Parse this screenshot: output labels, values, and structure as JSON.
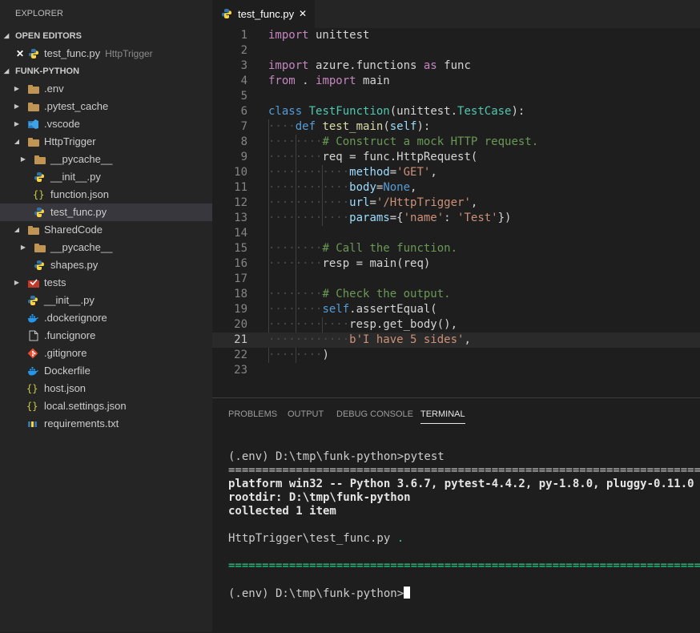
{
  "sidebar": {
    "title": "EXPLORER",
    "open_editors": {
      "header": "OPEN EDITORS",
      "items": [
        {
          "close": "✕",
          "label": "test_func.py",
          "description": "HttpTrigger"
        }
      ]
    },
    "project": {
      "header": "FUNK-PYTHON",
      "items": [
        {
          "label": ".env"
        },
        {
          "label": ".pytest_cache"
        },
        {
          "label": ".vscode"
        },
        {
          "label": "HttpTrigger"
        },
        {
          "label": "__pycache__"
        },
        {
          "label": "__init__.py"
        },
        {
          "label": "function.json"
        },
        {
          "label": "test_func.py"
        },
        {
          "label": "SharedCode"
        },
        {
          "label": "__pycache__"
        },
        {
          "label": "shapes.py"
        },
        {
          "label": "tests"
        },
        {
          "label": "__init__.py"
        },
        {
          "label": ".dockerignore"
        },
        {
          "label": ".funcignore"
        },
        {
          "label": ".gitignore"
        },
        {
          "label": "Dockerfile"
        },
        {
          "label": "host.json"
        },
        {
          "label": "local.settings.json"
        },
        {
          "label": "requirements.txt"
        }
      ]
    }
  },
  "editor": {
    "tab": {
      "label": "test_func.py",
      "close": "✕"
    },
    "current_line": 21,
    "lines": [
      {
        "n": "1",
        "tokens": [
          [
            "kw",
            "import"
          ],
          [
            "txt",
            " unittest"
          ]
        ]
      },
      {
        "n": "2",
        "tokens": []
      },
      {
        "n": "3",
        "tokens": [
          [
            "kw",
            "import"
          ],
          [
            "txt",
            " azure.functions "
          ],
          [
            "kw",
            "as"
          ],
          [
            "txt",
            " func"
          ]
        ]
      },
      {
        "n": "4",
        "tokens": [
          [
            "kw",
            "from"
          ],
          [
            "txt",
            " . "
          ],
          [
            "kw",
            "import"
          ],
          [
            "txt",
            " main"
          ]
        ]
      },
      {
        "n": "5",
        "tokens": []
      },
      {
        "n": "6",
        "tokens": [
          [
            "kwb",
            "class"
          ],
          [
            "txt",
            " "
          ],
          [
            "cls",
            "TestFunction"
          ],
          [
            "txt",
            "(unittest."
          ],
          [
            "cls",
            "TestCase"
          ],
          [
            "txt",
            "):"
          ]
        ]
      },
      {
        "n": "7",
        "tokens": [
          [
            "ws",
            "····"
          ],
          [
            "kwb",
            "def"
          ],
          [
            "txt",
            " "
          ],
          [
            "fn",
            "test_main"
          ],
          [
            "txt",
            "("
          ],
          [
            "prm",
            "self"
          ],
          [
            "txt",
            "):"
          ]
        ]
      },
      {
        "n": "8",
        "tokens": [
          [
            "ws",
            "········"
          ],
          [
            "cmt",
            "# Construct a mock HTTP request."
          ]
        ]
      },
      {
        "n": "9",
        "tokens": [
          [
            "ws",
            "········"
          ],
          [
            "txt",
            "req = func.HttpRequest("
          ]
        ]
      },
      {
        "n": "10",
        "tokens": [
          [
            "ws",
            "············"
          ],
          [
            "prm",
            "method"
          ],
          [
            "txt",
            "="
          ],
          [
            "str",
            "'GET'"
          ],
          [
            "txt",
            ","
          ]
        ]
      },
      {
        "n": "11",
        "tokens": [
          [
            "ws",
            "············"
          ],
          [
            "prm",
            "body"
          ],
          [
            "txt",
            "="
          ],
          [
            "kwb",
            "None"
          ],
          [
            "txt",
            ","
          ]
        ]
      },
      {
        "n": "12",
        "tokens": [
          [
            "ws",
            "············"
          ],
          [
            "prm",
            "url"
          ],
          [
            "txt",
            "="
          ],
          [
            "str",
            "'/HttpTrigger'"
          ],
          [
            "txt",
            ","
          ]
        ]
      },
      {
        "n": "13",
        "tokens": [
          [
            "ws",
            "············"
          ],
          [
            "prm",
            "params"
          ],
          [
            "txt",
            "={"
          ],
          [
            "str",
            "'name'"
          ],
          [
            "txt",
            ": "
          ],
          [
            "str",
            "'Test'"
          ],
          [
            "txt",
            "})"
          ]
        ]
      },
      {
        "n": "14",
        "tokens": []
      },
      {
        "n": "15",
        "tokens": [
          [
            "ws",
            "········"
          ],
          [
            "cmt",
            "# Call the function."
          ]
        ]
      },
      {
        "n": "16",
        "tokens": [
          [
            "ws",
            "········"
          ],
          [
            "txt",
            "resp = main(req)"
          ]
        ]
      },
      {
        "n": "17",
        "tokens": []
      },
      {
        "n": "18",
        "tokens": [
          [
            "ws",
            "········"
          ],
          [
            "cmt",
            "# Check the output."
          ]
        ]
      },
      {
        "n": "19",
        "tokens": [
          [
            "ws",
            "········"
          ],
          [
            "kwb",
            "self"
          ],
          [
            "txt",
            ".assertEqual("
          ]
        ]
      },
      {
        "n": "20",
        "tokens": [
          [
            "ws",
            "············"
          ],
          [
            "txt",
            "resp.get_body(),"
          ]
        ]
      },
      {
        "n": "21",
        "tokens": [
          [
            "ws",
            "············"
          ],
          [
            "str",
            "b'I have 5 sides'"
          ],
          [
            "txt",
            ","
          ]
        ]
      },
      {
        "n": "22",
        "tokens": [
          [
            "ws",
            "········"
          ],
          [
            "txt",
            ")"
          ]
        ]
      },
      {
        "n": "23",
        "tokens": []
      }
    ]
  },
  "panel": {
    "tabs": [
      "PROBLEMS",
      "OUTPUT",
      "DEBUG CONSOLE",
      "TERMINAL"
    ],
    "active_tab": "TERMINAL",
    "terminal": {
      "line1": "(.env) D:\\tmp\\funk-python>pytest",
      "separator1": "================================================================================================",
      "platform": "platform win32 -- Python 3.6.7, pytest-4.4.2, py-1.8.0, pluggy-0.11.0",
      "rootdir": "rootdir: D:\\tmp\\funk-python",
      "collected": "collected 1 item",
      "result_file": "HttpTrigger\\test_func.py",
      "result_dot": " .",
      "separator2": "================================================================================================",
      "prompt": "(.env) D:\\tmp\\funk-python>"
    }
  },
  "colors": {
    "background": "#1e1e1e",
    "sidebar": "#252526",
    "keyword": "#c586c0",
    "storage": "#569cd6",
    "class": "#4ec9b0",
    "function": "#dcdcaa",
    "string": "#ce9178",
    "comment": "#6a9955",
    "terminal_green": "#23d18b"
  }
}
